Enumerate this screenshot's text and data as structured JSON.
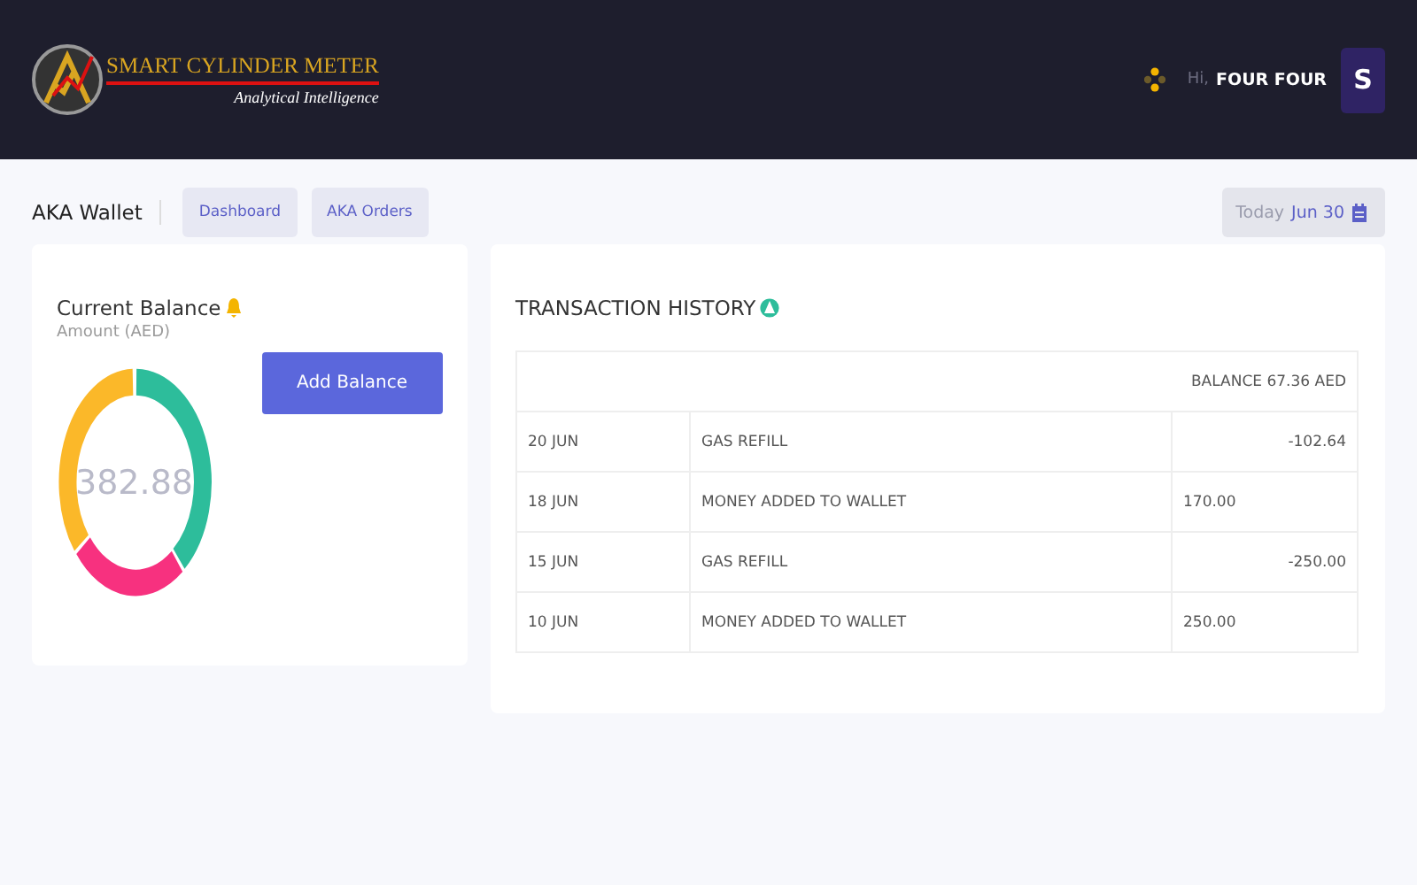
{
  "logo": {
    "title": "SMART CYLINDER METER",
    "tagline": "Analytical Intelligence"
  },
  "user": {
    "greeting": "Hi,",
    "name": "FOUR FOUR",
    "initial": "S"
  },
  "page_title": "AKA Wallet",
  "nav": [
    "Dashboard",
    "AKA Orders"
  ],
  "date": {
    "label": "Today",
    "value": "Jun 30"
  },
  "balance_card": {
    "title": "Current Balance",
    "subtitle": "Amount (AED)",
    "amount": "382.88",
    "button": "Add Balance"
  },
  "history": {
    "title": "TRANSACTION HISTORY",
    "balance": "BALANCE 67.36 AED",
    "rows": [
      {
        "date": "20 JUN",
        "description": "GAS REFILL",
        "amount": "-102.64",
        "kind": "debit"
      },
      {
        "date": "18 JUN",
        "description": "MONEY ADDED TO WALLET",
        "amount": "170.00",
        "kind": "credit"
      },
      {
        "date": "15 JUN",
        "description": "GAS REFILL",
        "amount": "-250.00",
        "kind": "debit"
      },
      {
        "date": "10 JUN",
        "description": "MONEY ADDED TO WALLET",
        "amount": "250.00",
        "kind": "credit"
      }
    ]
  }
}
